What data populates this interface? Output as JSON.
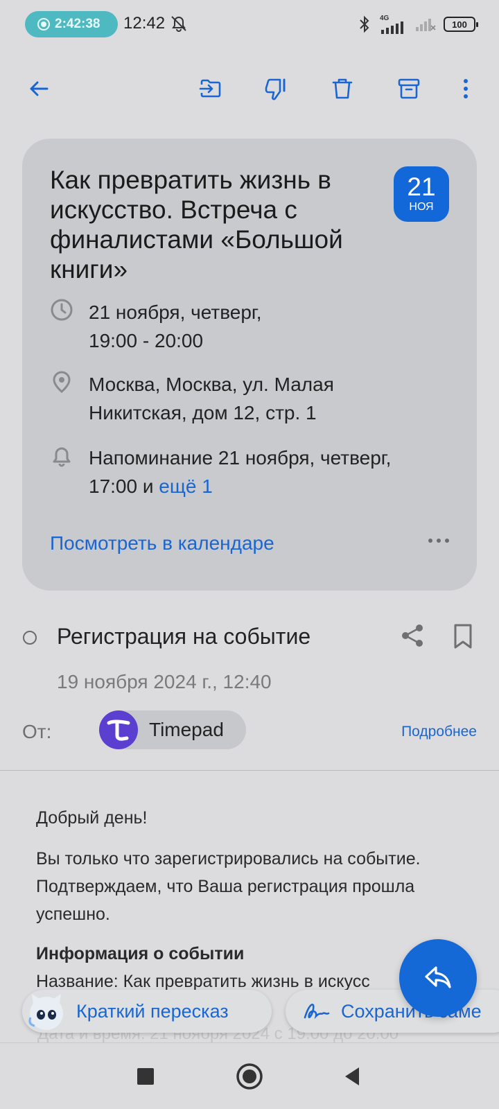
{
  "status_bar": {
    "recording_time": "2:42:38",
    "clock": "12:42",
    "network": "4G",
    "battery": "100"
  },
  "toolbar": {
    "icons": [
      "back-arrow-icon",
      "move-to-folder-icon",
      "spam-icon",
      "delete-icon",
      "archive-icon",
      "more-icon"
    ]
  },
  "event": {
    "title": "Как превратить жизнь в искусство. Встреча с финалистами «Большой книги»",
    "badge_day": "21",
    "badge_month": "НОЯ",
    "datetime_line1": "21 ноября, четверг,",
    "datetime_line2": "19:00 - 20:00",
    "location_line1": "Москва, Москва, ул. Малая",
    "location_line2": "Никитская, дом 12, стр. 1",
    "reminder_line1": "Напоминание 21 ноября, четверг,",
    "reminder_line2": "17:00 и",
    "reminder_more": "ещё 1",
    "calendar_link": "Посмотреть в календаре"
  },
  "message": {
    "subject": "Регистрация на событие",
    "date": "19 ноября 2024 г., 12:40",
    "from_label": "От:",
    "sender_name": "Timepad",
    "details_link": "Подробнее",
    "greeting": "Добрый день!",
    "paragraph": "Вы только что зарегистрировались на событие. Подтверждаем, что Ваша регистрация прошла успешно.",
    "section_title": "Информация о событии",
    "name_line": "Название: Как превратить жизнь в искусс",
    "partial_line": "Дата и время: 21 ноября 2024 с 19:00 до 20:00"
  },
  "chips": {
    "summary": "Краткий пересказ",
    "save_note": "Сохранить заме"
  },
  "colors": {
    "accent": "#1966d2",
    "badge": "#1368d9",
    "sender_avatar": "#5b3fd1",
    "recording_pill": "#4fb9c1"
  }
}
